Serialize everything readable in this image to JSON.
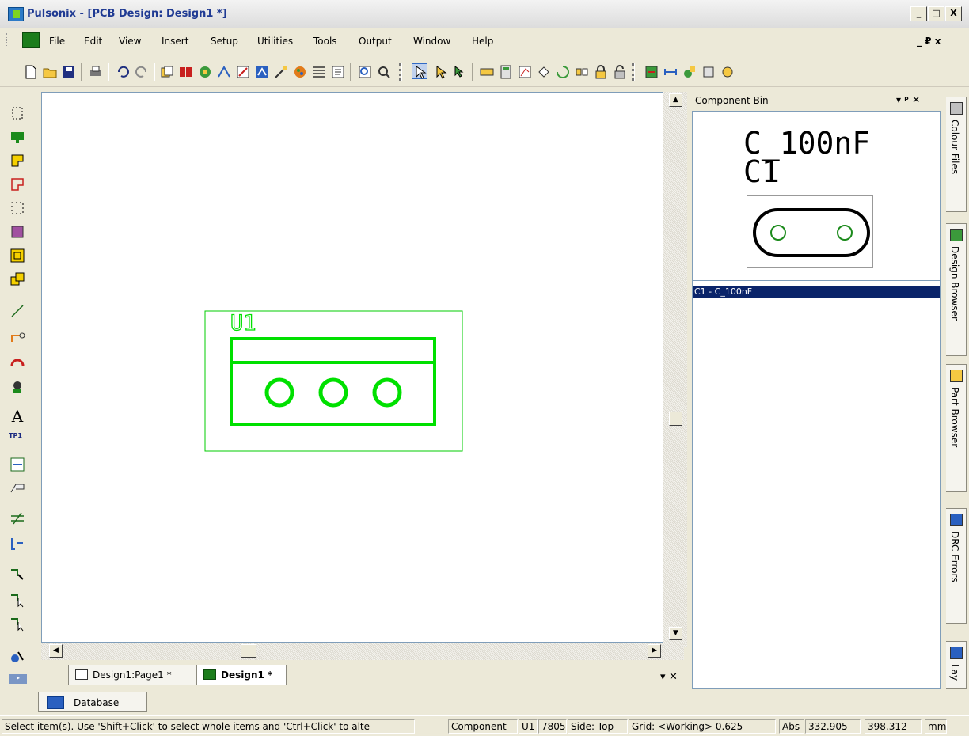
{
  "window": {
    "title": "Pulsonix - [PCB Design: Design1 *]",
    "minimize_label": "_",
    "restore_label": "□",
    "close_label": "X"
  },
  "menubar": {
    "items": [
      "File",
      "Edit",
      "View",
      "Insert",
      "Setup",
      "Utilities",
      "Tools",
      "Output",
      "Window",
      "Help"
    ],
    "mdi_controls": "_ ₽ x"
  },
  "toolbar": {
    "icons": [
      "new-icon",
      "open-icon",
      "save-icon",
      "print-icon",
      "undo-icon",
      "redo-icon",
      "copy-icon",
      "library-icon",
      "properties-icon",
      "route-icon",
      "netlist-icon",
      "report-icon",
      "rules-icon",
      "colour-icon",
      "layer-icon",
      "find-icon",
      "zoom-icon",
      "zoom-window-icon",
      "select-icon",
      "select-alt-icon",
      "select-all-icon",
      "measure-icon",
      "calculator-icon",
      "board-icon",
      "move-icon",
      "rotate-icon",
      "flip-icon",
      "lock-icon",
      "unlock-icon",
      "drc-icon",
      "measure-dim-icon",
      "route-tool-icon",
      "options-icon",
      "circle-icon"
    ]
  },
  "left_toolbar": {
    "icons": [
      "add-component-icon",
      "pad-icon",
      "fill-icon",
      "outline-icon",
      "area-icon",
      "template-icon",
      "shape-icon",
      "copy-shape-icon",
      "line-icon",
      "connection-icon",
      "arc-icon",
      "via-icon",
      "text-icon",
      "testpoint-icon",
      "dimension-icon",
      "label-icon",
      "split-icon",
      "interactive-route-icon",
      "net-route-icon",
      "auto-route-icon",
      "route-select-icon",
      "color-set-icon"
    ],
    "text_tool_label": "A",
    "testpoint_label": "TP1"
  },
  "canvas": {
    "component_label": "U1",
    "accent": "#00e000",
    "outline_color": "#00cc00"
  },
  "tabs": [
    {
      "label": "Design1:Page1 *",
      "active": false
    },
    {
      "label": "Design1 *",
      "active": true
    }
  ],
  "tabs_controls": "▾ ✕",
  "component_bin": {
    "title": "Component Bin",
    "controls": "▾ ᵖ ✕",
    "preview_name": "C_100nF",
    "preview_ref": "C1",
    "list": [
      "C1 - C_100nF"
    ]
  },
  "side_tabs": [
    "Colour Files",
    "Design Browser",
    "Part Browser",
    "DRC Errors",
    "Lay"
  ],
  "database_tab": {
    "label": "Database"
  },
  "status": {
    "message": "Select item(s). Use 'Shift+Click' to select whole items and 'Ctrl+Click' to alte",
    "type": "Component",
    "ref": "U1",
    "part": "7805",
    "side": "Side: Top",
    "grid": "Grid: <Working> 0.625",
    "mode": "Abs",
    "x": "332.905-",
    "y": "398.312-",
    "units": "mm"
  }
}
